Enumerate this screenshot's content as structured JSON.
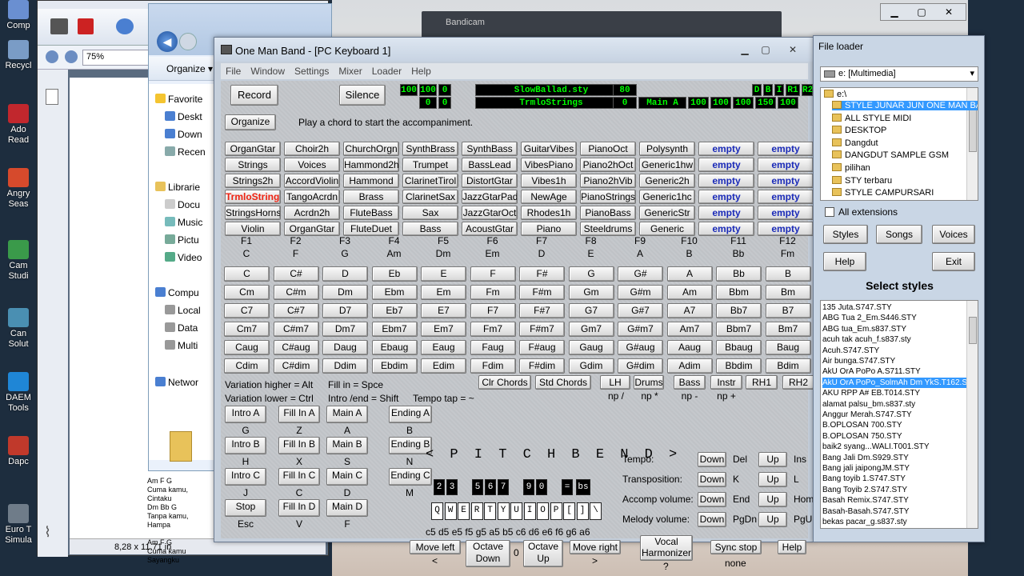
{
  "desktop": {
    "icons": [
      {
        "label": "Comp"
      },
      {
        "label": "Recycl"
      },
      {
        "label": "Ado Read"
      },
      {
        "label": "Angry Seas"
      },
      {
        "label": "Cam Studi"
      },
      {
        "label": "Can Solut"
      },
      {
        "label": "DAEM Tools"
      },
      {
        "label": "Dapc"
      },
      {
        "label": "Euro T Simula"
      }
    ]
  },
  "acrobat": {
    "zoom": "75%",
    "page_size": "8,28 x 11,71 in",
    "lyrics": [
      "Am F G",
      "Cuma kamu, Cintaku",
      "Dm Bb G",
      "Tanpa kamu, Hampa",
      "",
      "Am F G",
      "Cuma kamu Sayangku"
    ]
  },
  "explorer": {
    "organize": "Organize ▾",
    "tree": [
      "Favorite",
      "Deskt",
      "Down",
      "Recen",
      "Librarie",
      "Docu",
      "Music",
      "Pictu",
      "Video",
      "Compu",
      "Local",
      "Data",
      "Multi",
      "Networ"
    ]
  },
  "video": {
    "tab_text": "Bandicam"
  },
  "omb": {
    "title": "One Man Band - [PC Keyboard 1]",
    "menu": [
      "File",
      "Window",
      "Settings",
      "Mixer",
      "Loader",
      "Help"
    ],
    "record": "Record",
    "silence": "Silence",
    "organize": "Organize",
    "status": "Play a chord to start the accompaniment.",
    "lcd_row1": [
      "100",
      "100",
      "0",
      "SlowBallad.sty",
      "80",
      "D",
      "B",
      "I",
      "R1",
      "R2"
    ],
    "lcd_row2": [
      "0",
      "0",
      "TrmloStrings",
      "0",
      "Main A",
      "100",
      "100",
      "100",
      "150",
      "100"
    ],
    "voices": [
      [
        "OrganGtar",
        "Choir2h",
        "ChurchOrgn",
        "SynthBrass",
        "SynthBass",
        "GuitarVibes",
        "PianoOct",
        "Polysynth",
        "empty",
        "empty"
      ],
      [
        "Strings",
        "Voices",
        "Hammond2h",
        "Trumpet",
        "BassLead",
        "VibesPiano",
        "Piano2hOct",
        "Generic1hw",
        "empty",
        "empty"
      ],
      [
        "Strings2h",
        "AccordViolin",
        "Hammond",
        "ClarinetTirol",
        "DistortGtar",
        "Vibes1h",
        "Piano2hVib",
        "Generic2h",
        "empty",
        "empty"
      ],
      [
        "TrmloStrings",
        "TangoAcrdn",
        "Brass",
        "ClarinetSax",
        "JazzGtarPad",
        "NewAge",
        "PianoStrings",
        "Generic1hc",
        "empty",
        "empty"
      ],
      [
        "StringsHorns",
        "Acrdn2h",
        "FluteBass",
        "Sax",
        "JazzGtarOct",
        "Rhodes1h",
        "PianoBass",
        "GenericStr",
        "empty",
        "empty"
      ],
      [
        "Violin",
        "OrganGtar",
        "FluteDuet",
        "Bass",
        "AcoustGtar",
        "Piano",
        "Steeldrums",
        "Generic",
        "empty",
        "empty"
      ]
    ],
    "fkeys": [
      "F1",
      "F2",
      "F3",
      "F4",
      "F5",
      "F6",
      "F7",
      "F8",
      "F9",
      "F10",
      "F11",
      "F12"
    ],
    "fkey_chords": [
      "C",
      "F",
      "G",
      "Am",
      "Dm",
      "Em",
      "D",
      "E",
      "A",
      "B",
      "Bb",
      "Fm"
    ],
    "chords": [
      [
        "C",
        "C#",
        "D",
        "Eb",
        "E",
        "F",
        "F#",
        "G",
        "G#",
        "A",
        "Bb",
        "B"
      ],
      [
        "Cm",
        "C#m",
        "Dm",
        "Ebm",
        "Em",
        "Fm",
        "F#m",
        "Gm",
        "G#m",
        "Am",
        "Bbm",
        "Bm"
      ],
      [
        "C7",
        "C#7",
        "D7",
        "Eb7",
        "E7",
        "F7",
        "F#7",
        "G7",
        "G#7",
        "A7",
        "Bb7",
        "B7"
      ],
      [
        "Cm7",
        "C#m7",
        "Dm7",
        "Ebm7",
        "Em7",
        "Fm7",
        "F#m7",
        "Gm7",
        "G#m7",
        "Am7",
        "Bbm7",
        "Bm7"
      ],
      [
        "Caug",
        "C#aug",
        "Daug",
        "Ebaug",
        "Eaug",
        "Faug",
        "F#aug",
        "Gaug",
        "G#aug",
        "Aaug",
        "Bbaug",
        "Baug"
      ],
      [
        "Cdim",
        "C#dim",
        "Ddim",
        "Ebdim",
        "Edim",
        "Fdim",
        "F#dim",
        "Gdim",
        "G#dim",
        "Adim",
        "Bbdim",
        "Bdim"
      ]
    ],
    "hints": {
      "var_higher": "Variation higher = Alt",
      "var_lower": "Variation lower = Ctrl",
      "fill_in": "Fill in = Spce",
      "intro_end": "Intro /end = Shift",
      "tempo_tap": "Tempo tap = ~"
    },
    "clr_chords": "Clr Chords",
    "std_chords": "Std Chords",
    "parts": [
      {
        "label": "LH",
        "key": "np /"
      },
      {
        "label": "Drums",
        "key": "np *"
      },
      {
        "label": "Bass",
        "key": "np -"
      },
      {
        "label": "Instr",
        "key": "np +"
      },
      {
        "label": "RH1",
        "key": ""
      },
      {
        "label": "RH2",
        "key": ""
      }
    ],
    "sections": [
      [
        {
          "label": "Intro A",
          "key": "G"
        },
        {
          "label": "Fill In A",
          "key": "Z"
        },
        {
          "label": "Main A",
          "key": "A"
        },
        {
          "label": "Ending A",
          "key": "B"
        }
      ],
      [
        {
          "label": "Intro B",
          "key": "H"
        },
        {
          "label": "Fill In B",
          "key": "X"
        },
        {
          "label": "Main B",
          "key": "S"
        },
        {
          "label": "Ending B",
          "key": "N"
        }
      ],
      [
        {
          "label": "Intro C",
          "key": "J"
        },
        {
          "label": "Fill In C",
          "key": "C"
        },
        {
          "label": "Main C",
          "key": "D"
        },
        {
          "label": "Ending C",
          "key": "M"
        }
      ],
      [
        {
          "label": "Stop",
          "key": "Esc"
        },
        {
          "label": "Fill In D",
          "key": "V"
        },
        {
          "label": "Main D",
          "key": "F"
        }
      ]
    ],
    "pitchbend": "< P I T C H B E N D >",
    "upper_keys": [
      "2",
      "3",
      "5",
      "6",
      "7",
      "9",
      "0",
      "=",
      "bs"
    ],
    "lower_keys": [
      "Q",
      "W",
      "E",
      "R",
      "T",
      "Y",
      "U",
      "I",
      "O",
      "P",
      "[",
      "]",
      "\\"
    ],
    "notes": "c5 d5 e5 f5 g5 a5 b5 c6 d6 e6 f6 g6 a6",
    "controls": [
      {
        "label": "Tempo:",
        "down": "Down",
        "dkey": "Del",
        "up": "Up",
        "ukey": "Ins"
      },
      {
        "label": "Transposition:",
        "down": "Down",
        "dkey": "K",
        "up": "Up",
        "ukey": "L"
      },
      {
        "label": "Accomp volume:",
        "down": "Down",
        "dkey": "End",
        "up": "Up",
        "ukey": "Home"
      },
      {
        "label": "Melody volume:",
        "down": "Down",
        "dkey": "PgDn",
        "up": "Up",
        "ukey": "PgUp"
      }
    ],
    "move_left": "Move left",
    "move_left_key": "<",
    "octave_down": "Octave Down",
    "octave_value": "0",
    "octave_up": "Octave Up",
    "move_right": "Move right",
    "move_right_key": ">",
    "vocal": "Vocal Harmonizer",
    "vocal_key": "?",
    "sync_stop": "Sync stop",
    "sync_value": "none",
    "help": "Help"
  },
  "file_loader": {
    "title": "File loader",
    "drive": "e: [Multimedia]",
    "root": "e:\\",
    "folders": [
      "STYLE JUNAR JUN ONE MAN BAN",
      "ALL STYLE MIDI",
      "DESKTOP",
      "Dangdut",
      "DANGDUT SAMPLE GSM",
      "pilihan",
      "STY terbaru",
      "STYLE CAMPURSARI",
      "STYLE DANGDUT"
    ],
    "all_extensions": "All extensions",
    "styles": "Styles",
    "songs": "Songs",
    "voices": "Voices",
    "help": "Help",
    "exit": "Exit",
    "select_label": "Select styles",
    "files": [
      "135 Juta.S747.STY",
      "ABG Tua 2_Em.S446.STY",
      "ABG tua_Em.s837.STY",
      "acuh tak acuh_f.s837.sty",
      "Acuh.S747.STY",
      "Air bunga.S747.STY",
      "AkU OrA PoPo A.S711.STY",
      "AkU OrA PoPo_SolmAh Dm YkS.T162.STY",
      "AKU RPP A# EB.T014.STY",
      "alamat palsu_bm.s837.sty",
      "Anggur Merah.S747.STY",
      "B.OPLOSAN 700.STY",
      "B.OPLOSAN 750.STY",
      "baik2 syang...WALI.T001.STY",
      "Bang Jali Dm.S929.STY",
      "Bang jali jaipongJM.STY",
      "Bang toyib 1.S747.STY",
      "Bang Toyib 2.S747.STY",
      "Basah Remix.S747.STY",
      "Basah-Basah.S747.STY",
      "bekas pacar_g.s837.sty"
    ],
    "selected_file_index": 7
  }
}
